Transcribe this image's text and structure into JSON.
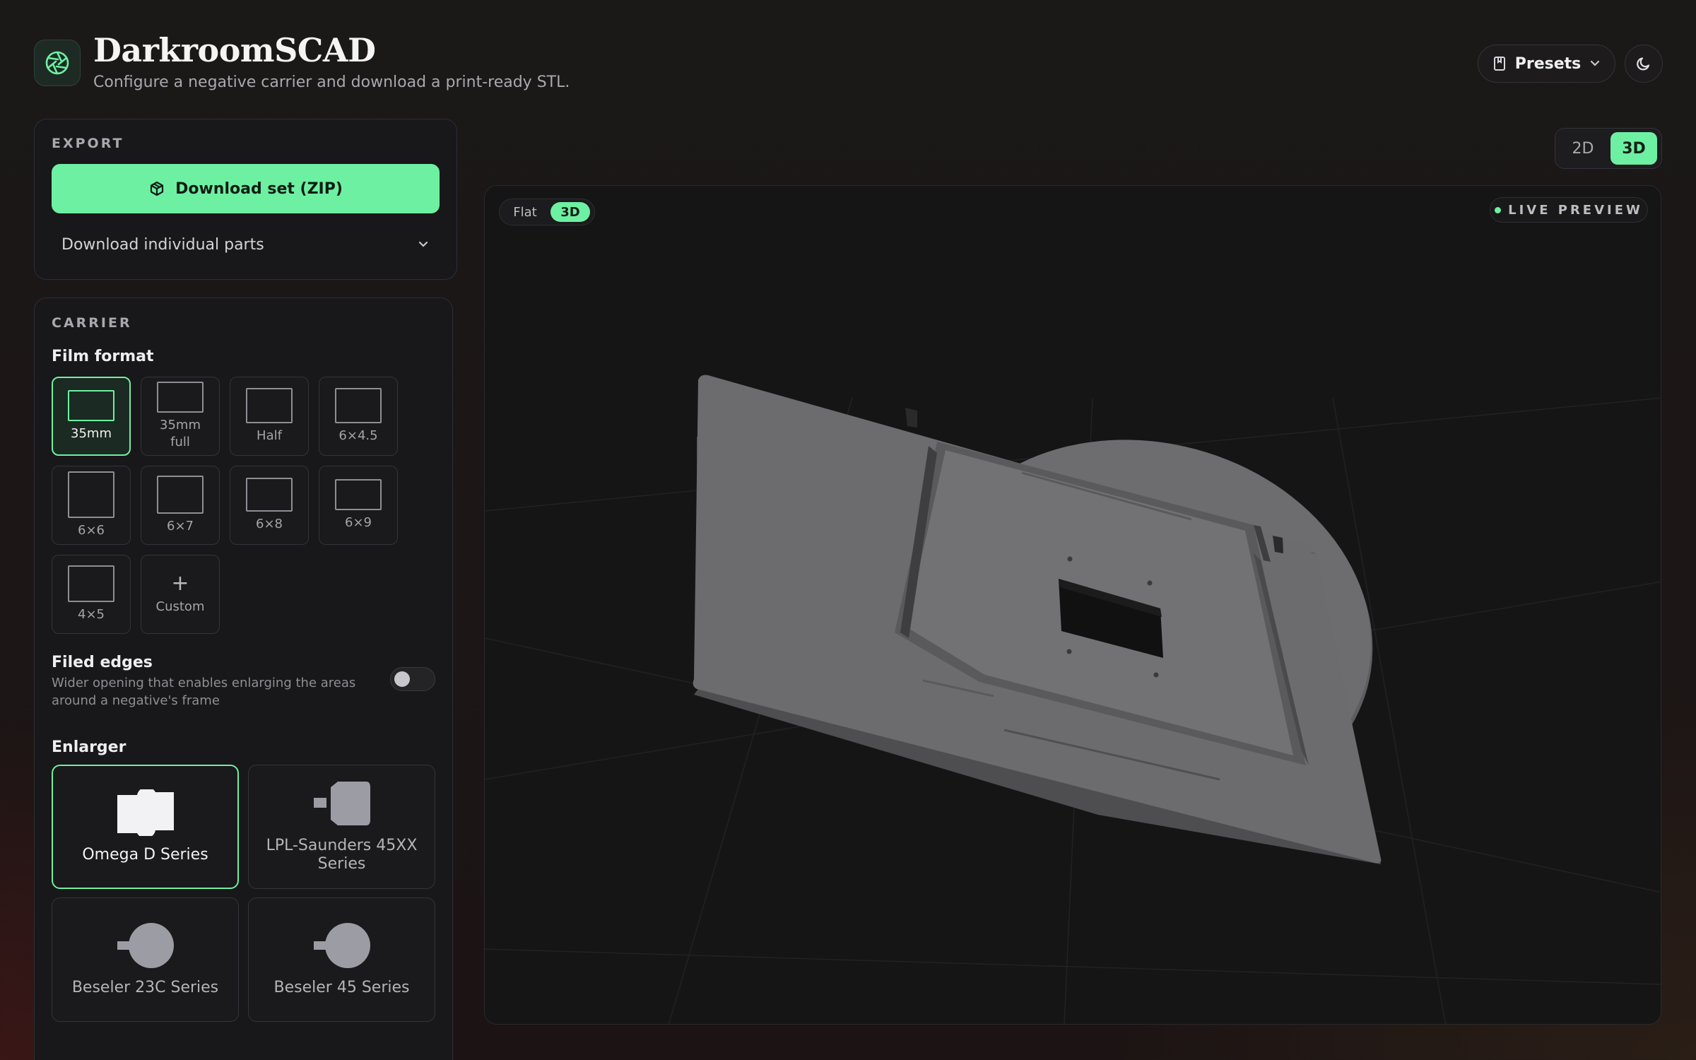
{
  "header": {
    "title": "DarkroomSCAD",
    "subtitle": "Configure a negative carrier and download a print-ready STL.",
    "logo_icon": "aperture-icon",
    "presets_label": "Presets",
    "theme_icon": "moon-icon"
  },
  "export": {
    "section_label": "EXPORT",
    "download_zip_label": "Download set (ZIP)",
    "download_parts_label": "Download individual parts"
  },
  "carrier": {
    "section_label": "CARRIER",
    "film_format_title": "Film format",
    "formats": [
      {
        "label": "35mm",
        "selected": true
      },
      {
        "label": "35mm full",
        "selected": false
      },
      {
        "label": "Half",
        "selected": false
      },
      {
        "label": "6×4.5",
        "selected": false
      },
      {
        "label": "6×6",
        "selected": false
      },
      {
        "label": "6×7",
        "selected": false
      },
      {
        "label": "6×8",
        "selected": false
      },
      {
        "label": "6×9",
        "selected": false
      },
      {
        "label": "4×5",
        "selected": false
      },
      {
        "label": "Custom",
        "selected": false
      }
    ],
    "filed_edges_title": "Filed edges",
    "filed_edges_desc": "Wider opening that enables enlarging the areas around a negative's frame",
    "filed_edges_on": false,
    "enlarger_title": "Enlarger",
    "enlargers": [
      {
        "label": "Omega D Series",
        "selected": true
      },
      {
        "label": "LPL-Saunders 45XX Series",
        "selected": false
      },
      {
        "label": "Beseler 23C Series",
        "selected": false
      },
      {
        "label": "Beseler 45 Series",
        "selected": false
      }
    ]
  },
  "preview": {
    "view_2d": "2D",
    "view_3d": "3D",
    "active_view": "3D",
    "mode_flat": "Flat",
    "mode_3d": "3D",
    "active_mode": "3D",
    "live_label": "LIVE PREVIEW"
  },
  "colors": {
    "accent": "#6ef0a2",
    "model": "#6e6e70"
  }
}
